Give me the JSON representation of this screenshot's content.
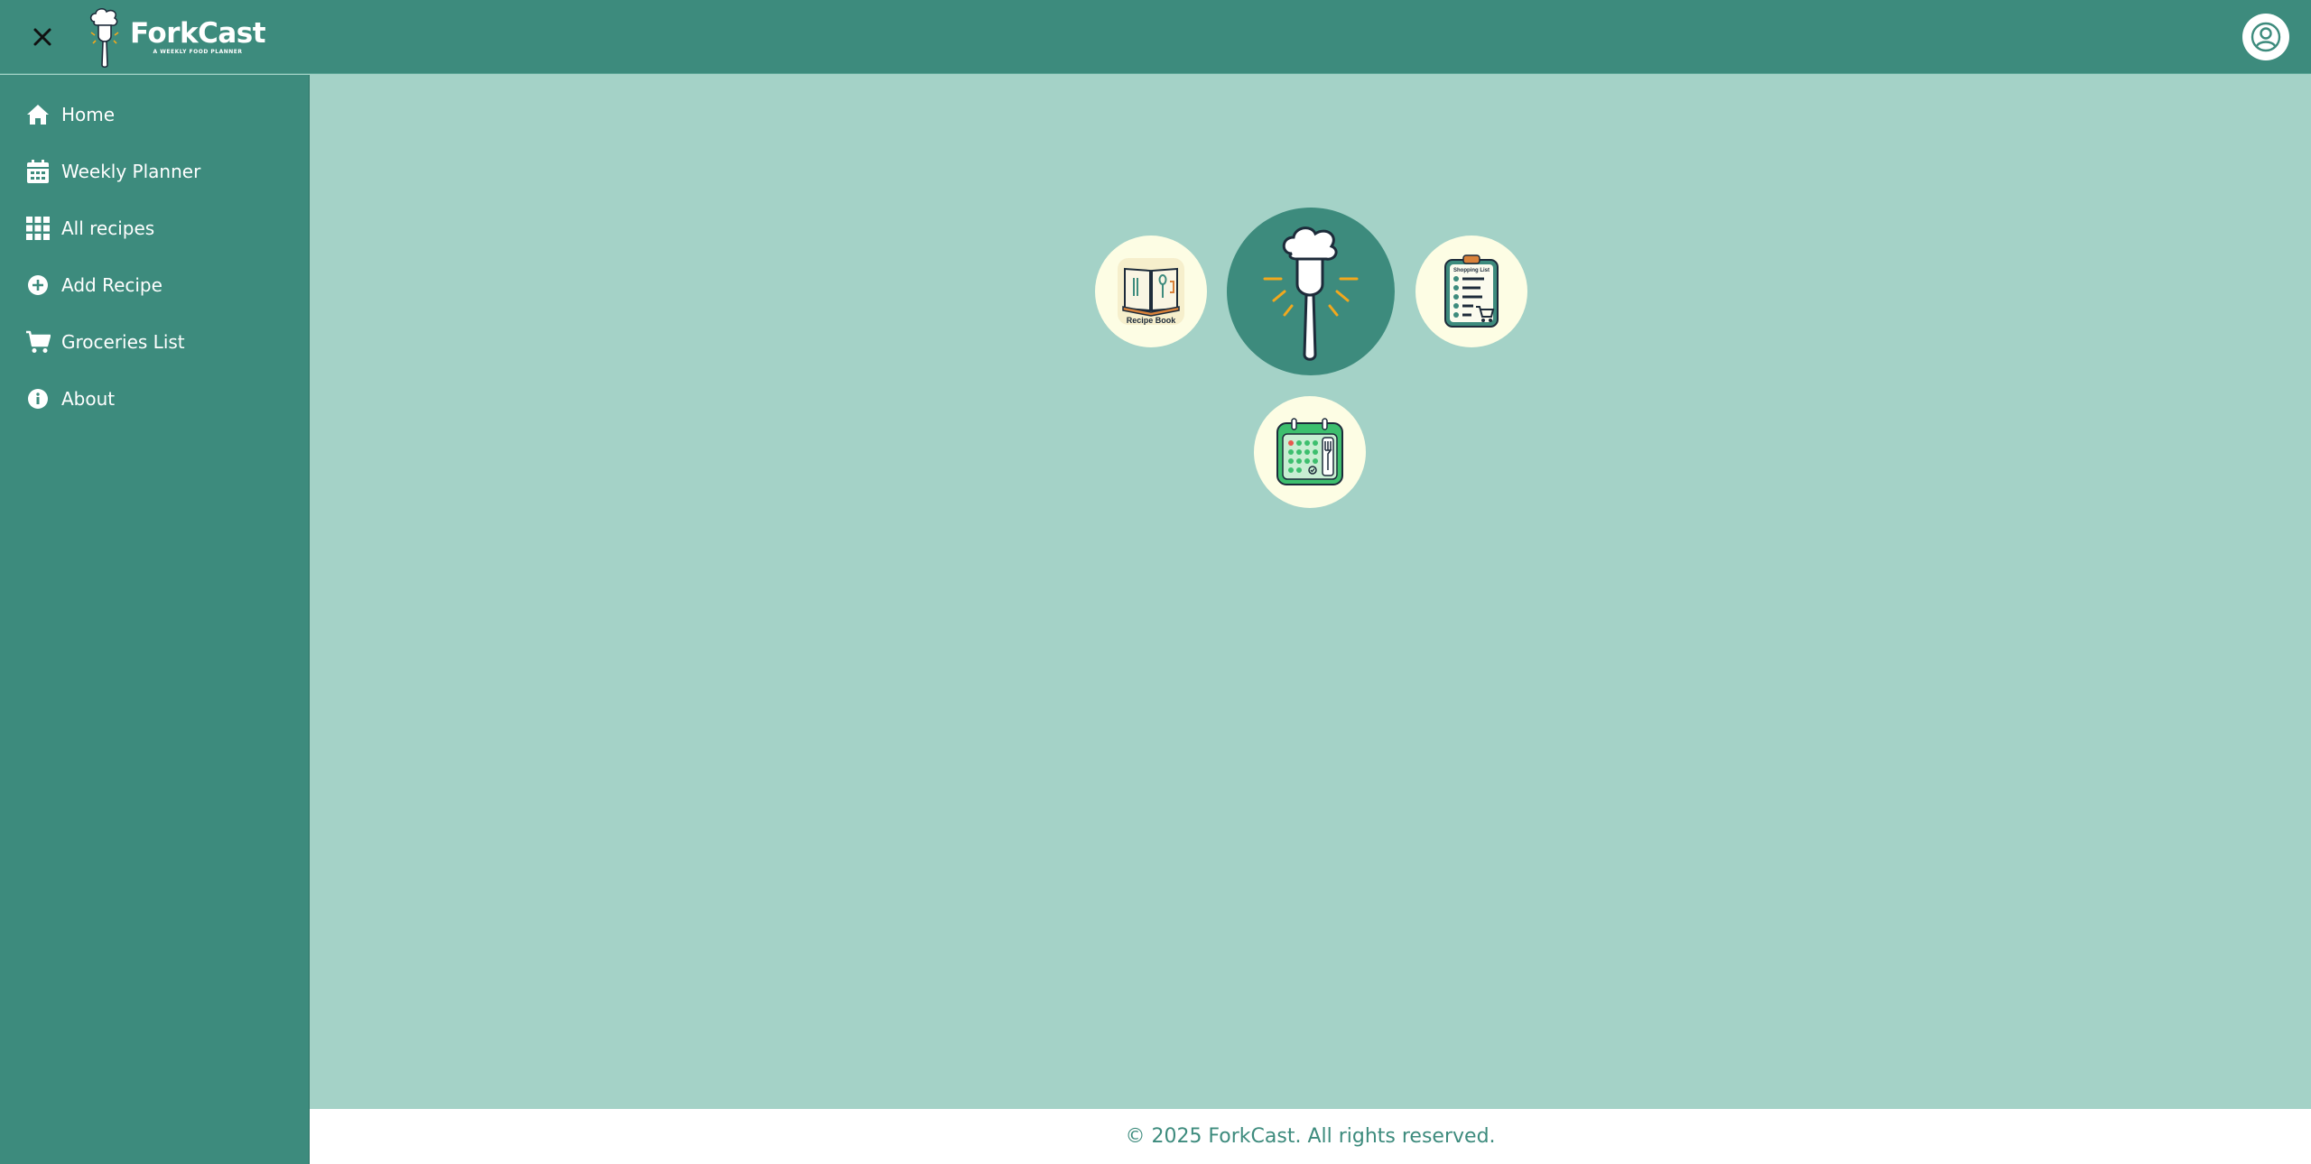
{
  "header": {
    "logo_title": "ForkCast",
    "logo_tagline": "A WEEKLY FOOD PLANNER",
    "close_icon": "close-icon",
    "avatar_icon": "user-circle-icon"
  },
  "sidebar": {
    "items": [
      {
        "label": "Home",
        "icon": "home-icon"
      },
      {
        "label": "Weekly Planner",
        "icon": "calendar-icon"
      },
      {
        "label": "All recipes",
        "icon": "grid-icon"
      },
      {
        "label": "Add Recipe",
        "icon": "plus-circle-icon"
      },
      {
        "label": "Groceries List",
        "icon": "cart-icon"
      },
      {
        "label": "About",
        "icon": "info-icon"
      }
    ]
  },
  "hub": {
    "recipe_book_label": "Recipe Book",
    "shopping_list_label": "Shopping List",
    "center_icon": "chef-fork-icon",
    "planner_icon": "meal-calendar-icon"
  },
  "footer": {
    "text": "© 2025 ForkCast. All rights reserved."
  },
  "colors": {
    "brand": "#3d8b7d",
    "background": "#a4d2c7",
    "circle": "#fdfde4",
    "accent": "#f2a81d"
  }
}
